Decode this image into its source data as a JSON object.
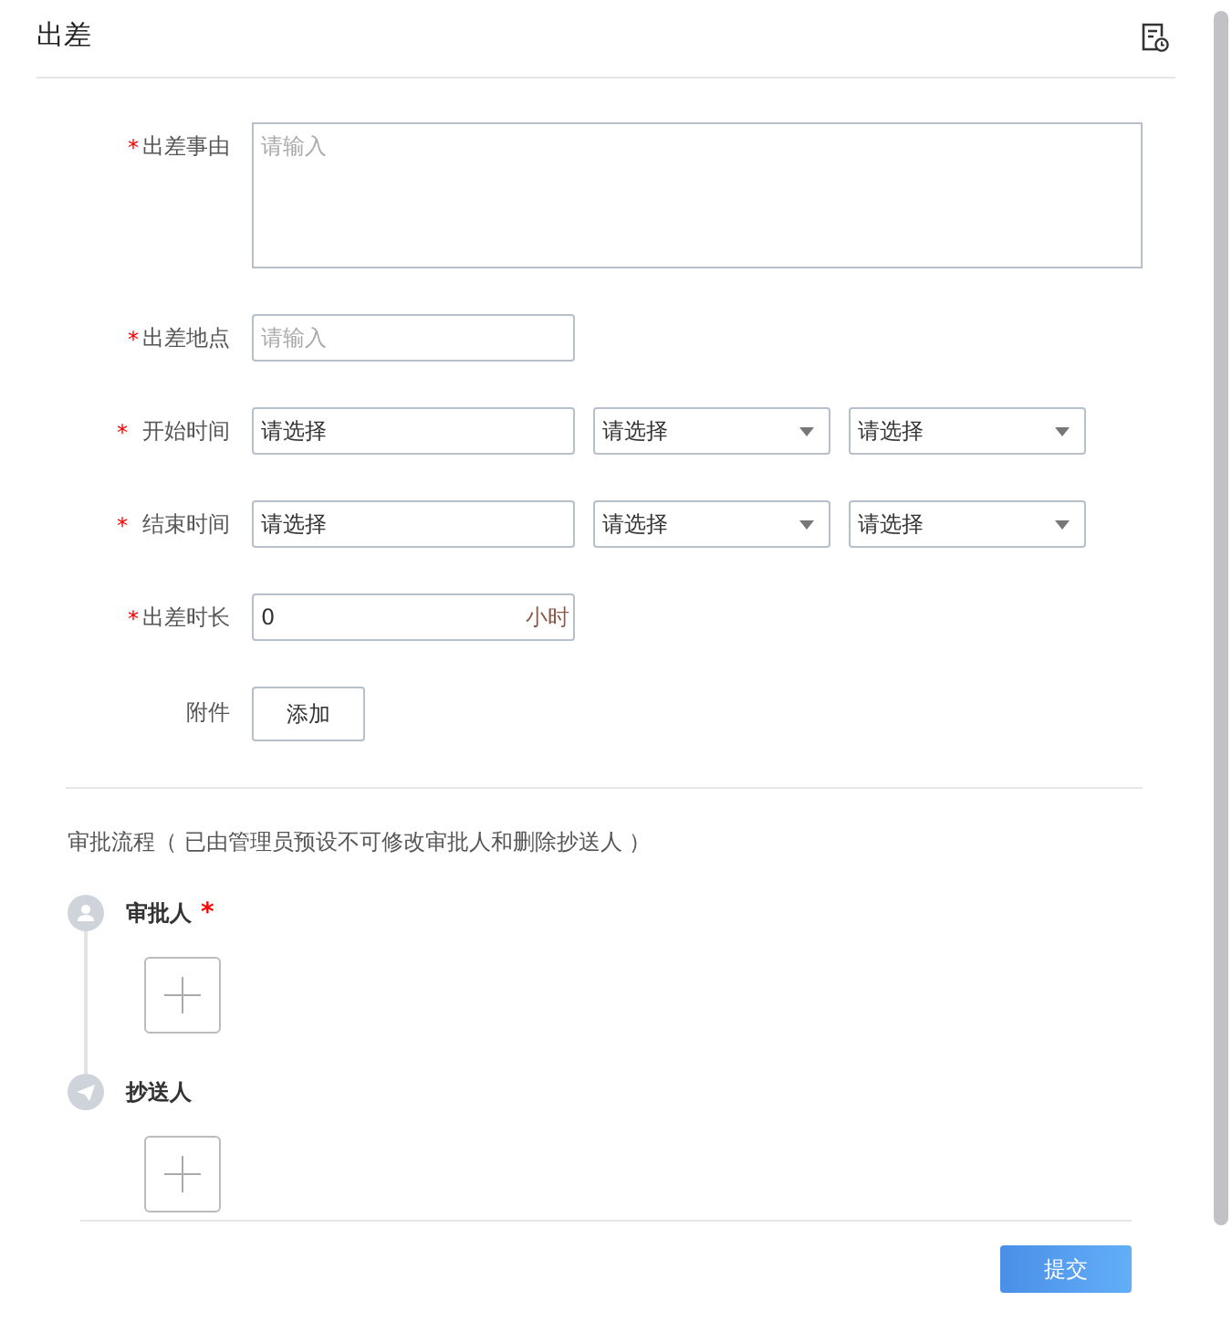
{
  "header": {
    "title": "出差"
  },
  "fields": [
    {
      "kind": "textarea",
      "label": "出差事由",
      "required_mark": "*",
      "placeholder": "请输入"
    },
    {
      "kind": "input",
      "label": "出差地点",
      "required_mark": "*",
      "placeholder": "请输入"
    },
    {
      "kind": "datetime",
      "label": "开始时间",
      "required_mark": "*",
      "date": "请选择",
      "selects": [
        "请选择",
        "请选择"
      ]
    },
    {
      "kind": "datetime",
      "label": "结束时间",
      "required_mark": "*",
      "date": "请选择",
      "selects": [
        "请选择",
        "请选择"
      ]
    },
    {
      "kind": "number",
      "label": "出差时长",
      "required_mark": "*",
      "value": "0",
      "unit": "小时"
    },
    {
      "kind": "upload",
      "label": "附件",
      "button": "添加"
    }
  ],
  "flow": {
    "title": "审批流程（ 已由管理员预设不可修改审批人和删除抄送人 ）",
    "nodes": [
      {
        "kind": "approver",
        "label": "审批人",
        "required_mark": "*"
      },
      {
        "kind": "cc",
        "label": "抄送人"
      }
    ]
  },
  "submit": "提交"
}
